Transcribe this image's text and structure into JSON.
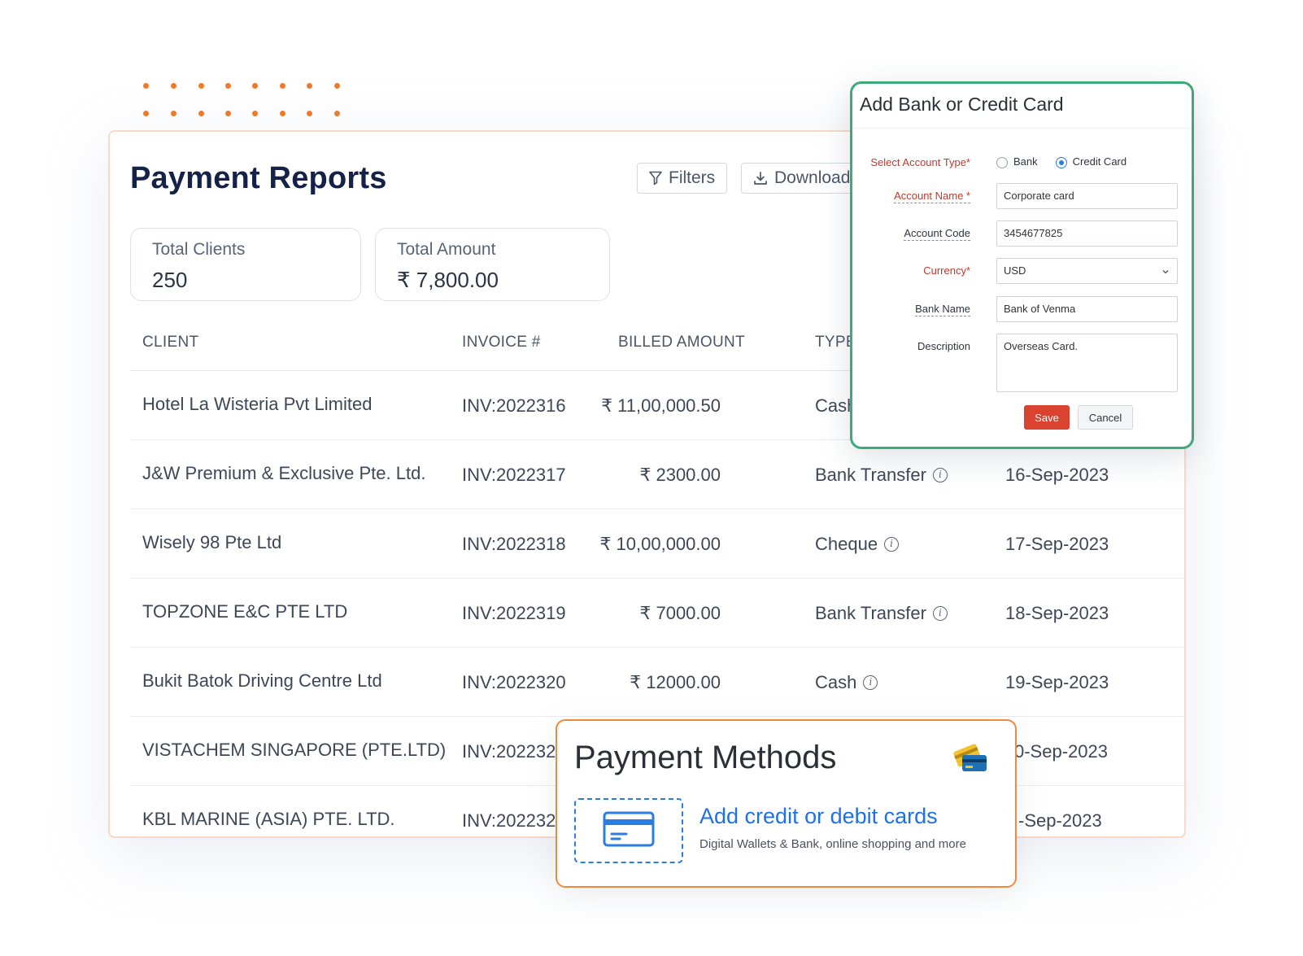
{
  "report": {
    "title": "Payment Reports",
    "filters_label": "Filters",
    "download_label": "Download",
    "total_clients_label": "Total Clients",
    "total_clients_value": "250",
    "total_amount_label": "Total Amount",
    "total_amount_value": "₹ 7,800.00",
    "columns": {
      "client": "CLIENT",
      "invoice": "INVOICE #",
      "amount": "BILLED AMOUNT",
      "type": "TYPE"
    },
    "rows": [
      {
        "client": "Hotel La Wisteria Pvt Limited",
        "invoice": "INV:2022316",
        "amount": "₹ 11,00,000.50",
        "type": "Cash",
        "date": ""
      },
      {
        "client": "J&W Premium & Exclusive Pte. Ltd.",
        "invoice": "INV:2022317",
        "amount": "₹ 2300.00",
        "type": "Bank Transfer",
        "date": "16-Sep-2023"
      },
      {
        "client": "Wisely 98 Pte Ltd",
        "invoice": "INV:2022318",
        "amount": "₹ 10,00,000.00",
        "type": "Cheque",
        "date": "17-Sep-2023"
      },
      {
        "client": "TOPZONE E&C PTE LTD",
        "invoice": "INV:2022319",
        "amount": "₹ 7000.00",
        "type": "Bank Transfer",
        "date": "18-Sep-2023"
      },
      {
        "client": "Bukit Batok Driving Centre Ltd",
        "invoice": "INV:2022320",
        "amount": "₹ 12000.00",
        "type": "Cash",
        "date": "19-Sep-2023"
      },
      {
        "client": "VISTACHEM SINGAPORE (PTE.LTD)",
        "invoice": "INV:202232",
        "amount": "",
        "type": "",
        "date": "0-Sep-2023"
      },
      {
        "client": "KBL MARINE (ASIA) PTE. LTD.",
        "invoice": "INV:202232",
        "amount": "",
        "type": "",
        "date": "-Sep-2023"
      }
    ]
  },
  "modal": {
    "title": "Add Bank or Credit Card",
    "account_type_label": "Select Account Type*",
    "account_type_options": [
      "Bank",
      "Credit Card"
    ],
    "account_type_selected": "Credit Card",
    "account_name_label": "Account Name *",
    "account_name_value": "Corporate card",
    "account_code_label": "Account Code",
    "account_code_value": "3454677825",
    "currency_label": "Currency*",
    "currency_value": "USD",
    "bank_name_label": "Bank Name",
    "bank_name_value": "Bank of Venma",
    "description_label": "Description",
    "description_value": "Overseas Card.",
    "save_label": "Save",
    "cancel_label": "Cancel"
  },
  "payment_methods": {
    "title": "Payment Methods",
    "add_cards_label": "Add credit or debit cards",
    "add_cards_sub": "Digital Wallets & Bank, online shopping and more"
  },
  "colors": {
    "accent_orange": "#f07a2a",
    "modal_border": "#3fa97a",
    "save_button": "#d9432f",
    "link_blue": "#1e72e8"
  },
  "icons": [
    "filter-icon",
    "download-icon",
    "caret-down-icon",
    "info-icon",
    "credit-card-icon",
    "cards-emoji-icon"
  ]
}
